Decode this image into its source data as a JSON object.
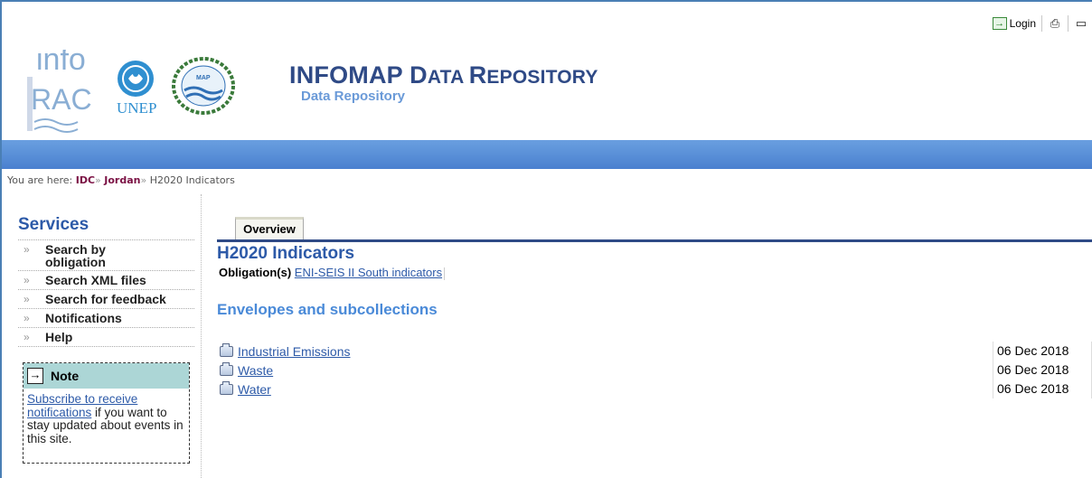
{
  "toolbar": {
    "login_label": "Login"
  },
  "header": {
    "title_big_1": "INFO",
    "title_big_2": "MAP ",
    "title_big_3": "D",
    "title_small_1": "ATA ",
    "title_big_4": "R",
    "title_small_2": "EPOSITORY",
    "subtitle": "Data Repository",
    "logo_info_text_1": "info",
    "logo_info_text_2": "RAC",
    "logo_unep_text": "UNEP",
    "logo_map_text": "MAP"
  },
  "breadcrumb": {
    "prefix": "You are here: ",
    "items": [
      {
        "label": "IDC"
      },
      {
        "label": "Jordan"
      },
      {
        "label": "H2020 Indicators"
      }
    ],
    "separator": "»"
  },
  "sidebar": {
    "title": "Services",
    "items": [
      {
        "label": "Search by obligation"
      },
      {
        "label": "Search XML files"
      },
      {
        "label": "Search for feedback"
      },
      {
        "label": "Notifications"
      },
      {
        "label": "Help"
      }
    ],
    "arrow": "»"
  },
  "note": {
    "title": "Note",
    "link_text": "Subscribe to receive notifications",
    "rest_text": " if you want to stay updated about events in this site."
  },
  "main": {
    "tab_label": "Overview",
    "title": "H2020 Indicators",
    "obligation_label": "Obligation(s)",
    "obligation_link": "ENI-SEIS II South indicators",
    "section_title": "Envelopes and subcollections",
    "envelopes": [
      {
        "name": "Industrial Emissions",
        "date": "06 Dec 2018"
      },
      {
        "name": "Waste",
        "date": "06 Dec 2018"
      },
      {
        "name": "Water",
        "date": "06 Dec 2018"
      }
    ]
  },
  "colors": {
    "title_blue": "#2f4a86",
    "link_blue": "#2d5aa8",
    "band_blue": "#5a8fd8",
    "breadcrumb_maroon": "#7b1144",
    "note_teal": "#acd6d6"
  }
}
